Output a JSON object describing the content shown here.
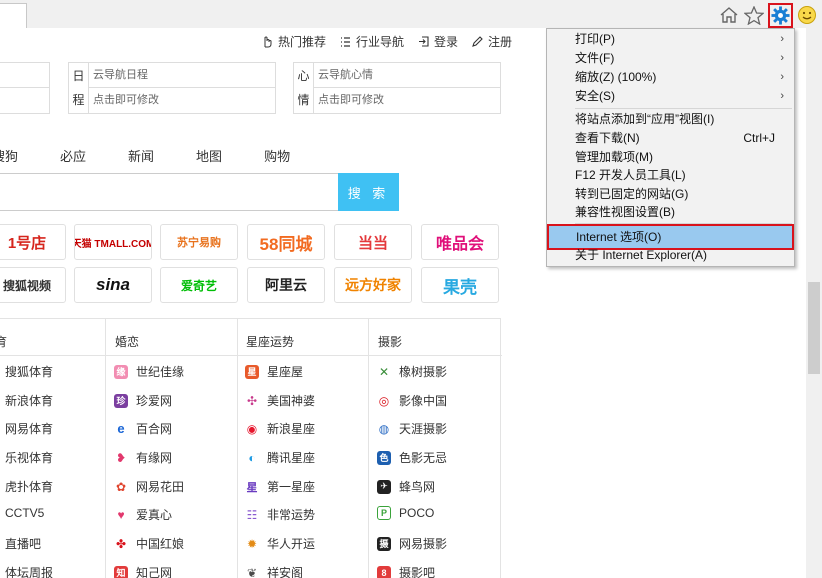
{
  "toolbar": {
    "icons": [
      "home-icon",
      "favorites-star-icon",
      "gear-icon",
      "smiley-icon"
    ]
  },
  "top_links": [
    {
      "label": "热门推荐",
      "icon": "hand-icon"
    },
    {
      "label": "行业导航",
      "icon": "list-icon"
    },
    {
      "label": "登录",
      "icon": "login-icon"
    },
    {
      "label": "注册",
      "icon": "pencil-icon"
    }
  ],
  "notes": {
    "calendar": {
      "side": [
        "日",
        "程"
      ],
      "title": "云导航日程",
      "hint": "点击即可修改"
    },
    "mood": {
      "side": [
        "心",
        "情"
      ],
      "title": "云导航心情",
      "hint": "点击即可修改"
    }
  },
  "search": {
    "tabs": [
      "搜狗",
      "必应",
      "新闻",
      "地图",
      "购物"
    ],
    "button": "搜 索"
  },
  "sites": {
    "row1": [
      "1号店",
      "天猫 TMALL.COM",
      "苏宁易购",
      "58同城",
      "当当",
      "唯品会"
    ],
    "row2": [
      "搜狐视频",
      "sina",
      "爱奇艺",
      "阿里云",
      "远方好家",
      "果壳"
    ]
  },
  "categories": [
    {
      "name": "育",
      "items": [
        "搜狐体育",
        "新浪体育",
        "网易体育",
        "乐视体育",
        "虎扑体育",
        "CCTV5",
        "直播吧",
        "体坛周报"
      ]
    },
    {
      "name": "婚恋",
      "items": [
        "世纪佳缘",
        "珍爱网",
        "百合网",
        "有缘网",
        "网易花田",
        "爱真心",
        "中国红娘",
        "知己网"
      ]
    },
    {
      "name": "星座运势",
      "items": [
        "星座屋",
        "美国神婆",
        "新浪星座",
        "腾讯星座",
        "第一星座",
        "非常运势",
        "华人开运",
        "祥安阁"
      ]
    },
    {
      "name": "摄影",
      "items": [
        "橡树摄影",
        "影像中国",
        "天涯摄影",
        "色影无忌",
        "蜂鸟网",
        "POCO",
        "网易摄影",
        "摄影吧"
      ]
    }
  ],
  "tools_menu": {
    "print": "打印(P)",
    "file": "文件(F)",
    "zoom": "缩放(Z) (100%)",
    "safety": "安全(S)",
    "add_to_apps": "将站点添加到“应用”视图(I)",
    "downloads": "查看下载(N)",
    "downloads_shortcut": "Ctrl+J",
    "addons": "管理加载项(M)",
    "devtools": "F12 开发人员工具(L)",
    "pinned": "转到已固定的网站(G)",
    "compat": "兼容性视图设置(B)",
    "internet_options": "Internet 选项(O)",
    "about": "关于 Internet Explorer(A)"
  },
  "colors": {
    "accent_highlight": "#99c9ef",
    "annotation_red": "#d9131c",
    "search_button": "#3fc1f3",
    "gear_blue": "#1a7fd4"
  }
}
